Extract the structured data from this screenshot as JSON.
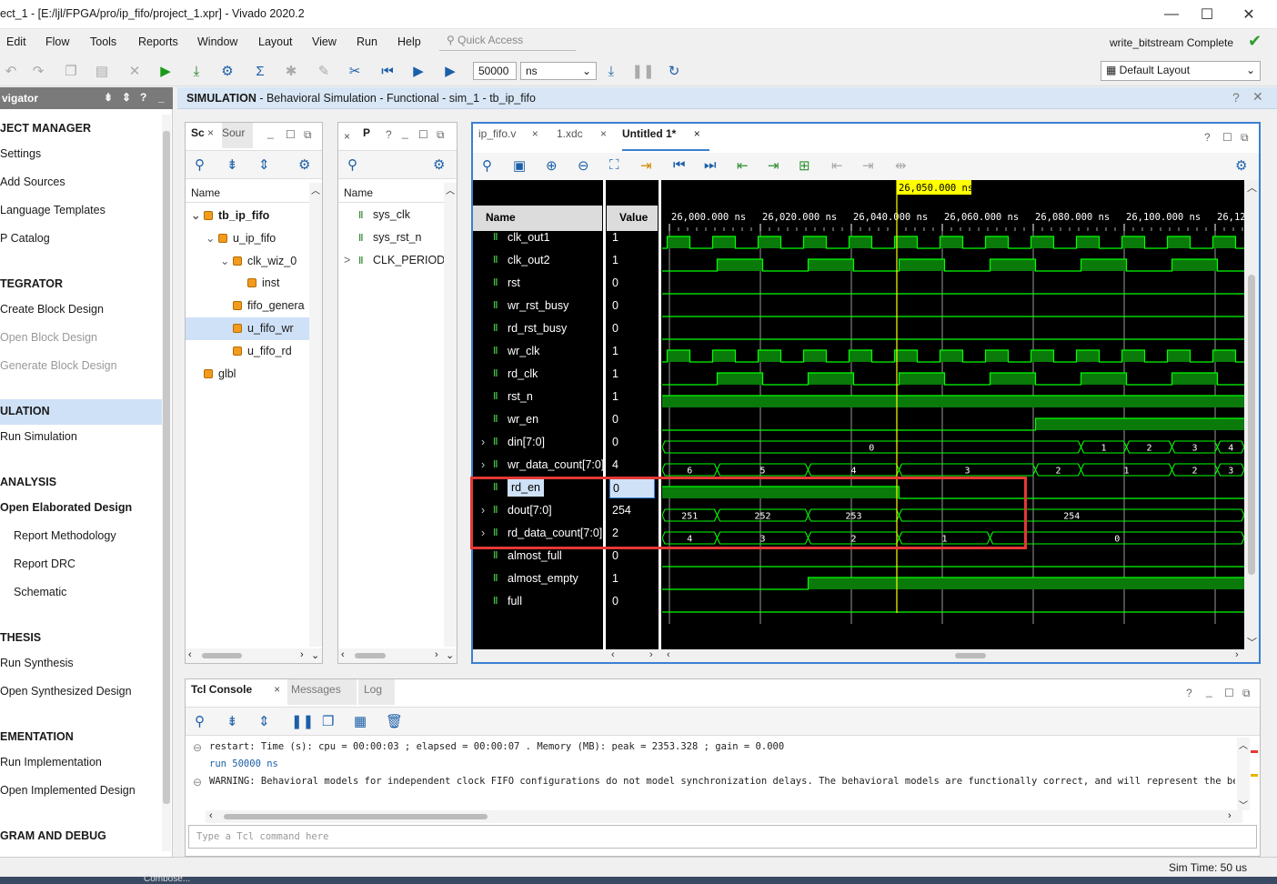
{
  "window": {
    "title": "ect_1 - [E:/ljl/FPGA/pro/ip_fifo/project_1.xpr] - Vivado 2020.2",
    "status": "write_bitstream Complete"
  },
  "menu": [
    "Edit",
    "Flow",
    "Tools",
    "Reports",
    "Window",
    "Layout",
    "View",
    "Run",
    "Help"
  ],
  "quick_access": {
    "placeholder": "Quick Access"
  },
  "toolbar": {
    "run_time": "50000",
    "time_unit": "ns",
    "layout": "Default Layout"
  },
  "sim_header": {
    "bold": "SIMULATION",
    "rest": " - Behavioral Simulation - Functional - sim_1 - tb_ip_fifo"
  },
  "navigator": {
    "title": "vigator",
    "items": [
      {
        "label": "JECT MANAGER",
        "type": "section"
      },
      {
        "label": "Settings",
        "type": "item"
      },
      {
        "label": "Add Sources",
        "type": "item"
      },
      {
        "label": "Language Templates",
        "type": "item"
      },
      {
        "label": "P Catalog",
        "type": "item"
      },
      {
        "label": "TEGRATOR",
        "type": "section"
      },
      {
        "label": "Create Block Design",
        "type": "item"
      },
      {
        "label": "Open Block Design",
        "type": "disabled"
      },
      {
        "label": "Generate Block Design",
        "type": "disabled"
      },
      {
        "label": "ULATION",
        "type": "active"
      },
      {
        "label": "Run Simulation",
        "type": "item"
      },
      {
        "label": "ANALYSIS",
        "type": "section"
      },
      {
        "label": "Open Elaborated Design",
        "type": "bold"
      },
      {
        "label": "Report Methodology",
        "type": "sub"
      },
      {
        "label": "Report DRC",
        "type": "sub"
      },
      {
        "label": "Schematic",
        "type": "sub"
      },
      {
        "label": "THESIS",
        "type": "section"
      },
      {
        "label": "Run Synthesis",
        "type": "item"
      },
      {
        "label": "Open Synthesized Design",
        "type": "item"
      },
      {
        "label": "EMENTATION",
        "type": "section"
      },
      {
        "label": "Run Implementation",
        "type": "item"
      },
      {
        "label": "Open Implemented Design",
        "type": "item"
      },
      {
        "label": "GRAM AND DEBUG",
        "type": "section"
      }
    ]
  },
  "scope_panel": {
    "tabs": [
      "Sc",
      "Sour"
    ],
    "col": "Name",
    "rows": [
      {
        "label": "tb_ip_fifo",
        "indent": 0,
        "exp": "v",
        "bold": true
      },
      {
        "label": "u_ip_fifo",
        "indent": 1,
        "exp": "v"
      },
      {
        "label": "clk_wiz_0",
        "indent": 2,
        "exp": "v"
      },
      {
        "label": "inst",
        "indent": 3,
        "exp": ""
      },
      {
        "label": "fifo_genera",
        "indent": 2,
        "exp": ""
      },
      {
        "label": "u_fifo_wr",
        "indent": 2,
        "exp": "",
        "sel": true
      },
      {
        "label": "u_fifo_rd",
        "indent": 2,
        "exp": ""
      },
      {
        "label": "glbl",
        "indent": 0,
        "exp": ""
      }
    ]
  },
  "objects_panel": {
    "tab": "P",
    "col": "Name",
    "rows": [
      {
        "label": "sys_clk",
        "exp": ""
      },
      {
        "label": "sys_rst_n",
        "exp": ""
      },
      {
        "label": "CLK_PERIOD",
        "exp": ">"
      }
    ]
  },
  "wave_tabs": [
    "ip_fifo.v",
    "1.xdc",
    "Untitled 1*"
  ],
  "wave": {
    "cursor_label": "26,050.000 ns",
    "headers": {
      "name": "Name",
      "value": "Value"
    },
    "time_ticks": [
      "26,000.000 ns",
      "26,020.000 ns",
      "26,040.000 ns",
      "26,060.000 ns",
      "26,080.000 ns",
      "26,100.000 ns",
      "26,12"
    ],
    "signals": [
      {
        "name": "clk_out1",
        "value": "1",
        "bus": false
      },
      {
        "name": "clk_out2",
        "value": "1",
        "bus": false
      },
      {
        "name": "rst",
        "value": "0",
        "bus": false
      },
      {
        "name": "wr_rst_busy",
        "value": "0",
        "bus": false
      },
      {
        "name": "rd_rst_busy",
        "value": "0",
        "bus": false
      },
      {
        "name": "wr_clk",
        "value": "1",
        "bus": false
      },
      {
        "name": "rd_clk",
        "value": "1",
        "bus": false
      },
      {
        "name": "rst_n",
        "value": "1",
        "bus": false
      },
      {
        "name": "wr_en",
        "value": "0",
        "bus": false
      },
      {
        "name": "din[7:0]",
        "value": "0",
        "bus": true
      },
      {
        "name": "wr_data_count[7:0]",
        "value": "4",
        "bus": true
      },
      {
        "name": "rd_en",
        "value": "0",
        "bus": false,
        "sel": true
      },
      {
        "name": "dout[7:0]",
        "value": "254",
        "bus": true
      },
      {
        "name": "rd_data_count[7:0]",
        "value": "2",
        "bus": true
      },
      {
        "name": "almost_full",
        "value": "0",
        "bus": false
      },
      {
        "name": "almost_empty",
        "value": "1",
        "bus": false
      },
      {
        "name": "full",
        "value": "0",
        "bus": false
      }
    ],
    "bus_labels": {
      "din": [
        "0",
        "1",
        "2",
        "3",
        "4"
      ],
      "wr_data_count": [
        "6",
        "5",
        "4",
        "3",
        "2",
        "1",
        "2",
        "3"
      ],
      "dout": [
        "251",
        "252",
        "253",
        "254"
      ],
      "rd_data_count": [
        "4",
        "3",
        "2",
        "1",
        "0"
      ]
    }
  },
  "console": {
    "tabs": [
      "Tcl Console",
      "Messages",
      "Log"
    ],
    "lines": [
      "restart: Time (s): cpu = 00:00:03 ; elapsed = 00:00:07 . Memory (MB): peak = 2353.328 ; gain = 0.000",
      "run 50000 ns",
      "WARNING: Behavioral models for independent clock FIFO configurations do not model synchronization delays. The behavioral models are functionally correct, and will represent the behavior of"
    ],
    "placeholder": "Type a Tcl command here"
  },
  "status": {
    "sim_time": "Sim Time: 50 us"
  },
  "taskbar": {
    "app": "Compose..."
  },
  "colors": {
    "accent": "#3c7fd1",
    "wave_green": "#00ff00",
    "wave_fill": "#0a7a0a",
    "cursor": "#ffff00",
    "highlight_box": "#e53935"
  }
}
